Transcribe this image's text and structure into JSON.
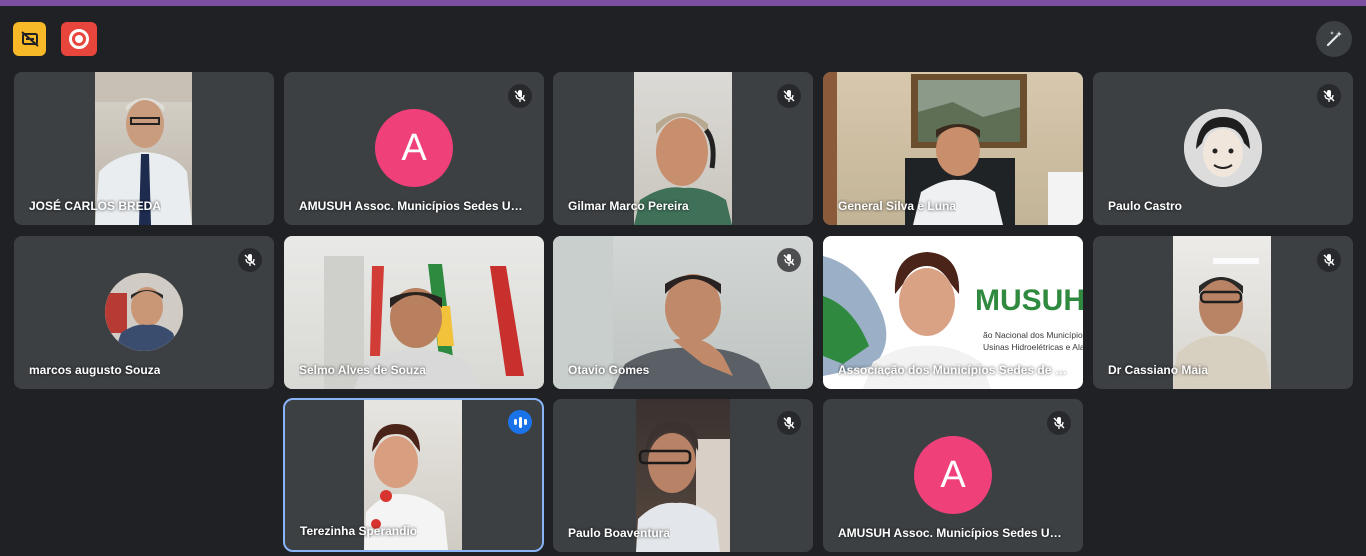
{
  "toolbar": {
    "captions_icon": "captions-off-icon",
    "record_icon": "record-icon",
    "effects_icon": "magic-wand-icon"
  },
  "colors": {
    "accent_bar": "#7d4fa3",
    "tile_bg": "#3c4043",
    "avatar_pink": "#f0407a",
    "speaking_blue": "#1a73e8",
    "captions_yellow": "#f7b928",
    "record_red": "#e8453c"
  },
  "participants": [
    {
      "name": "JOSÉ CARLOS BREDA",
      "muted": false
    },
    {
      "name": "AMUSUH Assoc. Municípios Sedes Usinas Hidroelétricas",
      "avatar_letter": "A",
      "muted": true
    },
    {
      "name": "Gilmar Marco Pereira",
      "muted": true
    },
    {
      "name": "General Silva e Luna",
      "muted": false
    },
    {
      "name": "Paulo Castro",
      "muted": true
    },
    {
      "name": "marcos augusto Souza",
      "muted": true
    },
    {
      "name": "Selmo Alves de Souza",
      "muted": false
    },
    {
      "name": "Otavio Gomes",
      "muted": true
    },
    {
      "name": "Associação dos Municípios Sedes de Usinas",
      "muted": false
    },
    {
      "name": "Dr Cassiano Maia",
      "muted": true
    },
    {
      "name": "Terezinha Sperandio",
      "muted": false,
      "speaking": true
    },
    {
      "name": "Paulo Boaventura",
      "muted": true
    },
    {
      "name": "AMUSUH Assoc. Municípios Sedes Usinas Hidroelétricas",
      "avatar_letter": "A",
      "muted": true
    }
  ],
  "logo_text": {
    "brand": "MUSUH",
    "line1": "ão Nacional dos Municípios",
    "line2": "Usinas Hidroelétricas e Alag"
  }
}
